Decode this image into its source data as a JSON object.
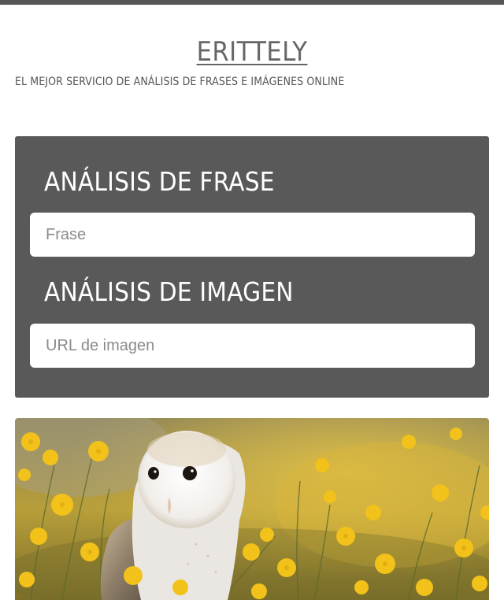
{
  "header": {
    "title": "ERITTELY",
    "tagline": "EL MEJOR SERVICIO DE ANÁLISIS DE FRASES E IMÁGENES ONLINE"
  },
  "phrase_section": {
    "heading": "ANÁLISIS DE FRASE",
    "input_placeholder": "Frase",
    "input_value": ""
  },
  "image_section": {
    "heading": "ANÁLISIS DE IMAGEN",
    "input_placeholder": "URL de imagen",
    "input_value": ""
  },
  "hero_image": {
    "subject": "barn owl in yellow wildflower field"
  },
  "colors": {
    "top_bar": "#555555",
    "panel": "#595959",
    "title": "#666666"
  }
}
